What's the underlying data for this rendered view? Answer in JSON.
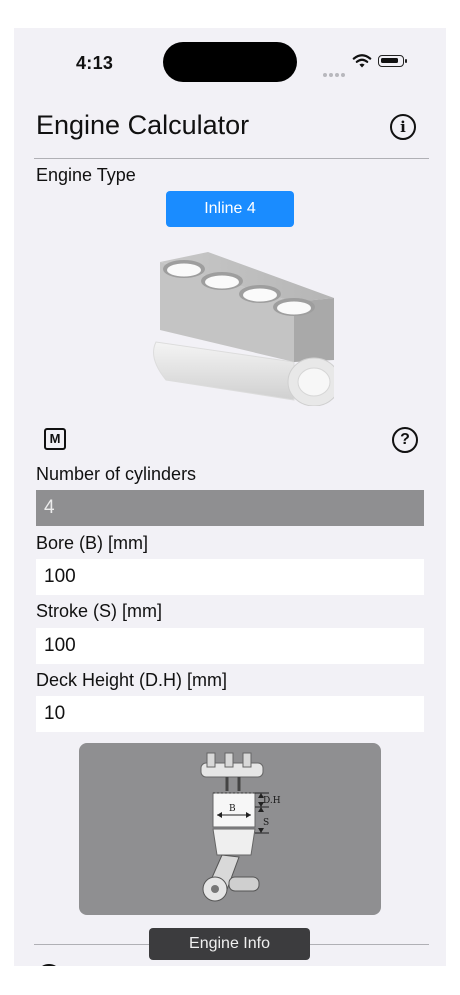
{
  "status_bar": {
    "time": "4:13"
  },
  "header": {
    "title": "Engine Calculator",
    "info_icon": "info-circle-icon"
  },
  "engine_type": {
    "label": "Engine Type",
    "selected": "Inline 4",
    "button_color": "#1a8cff"
  },
  "controls": {
    "mode_button": "M",
    "help_button": "?"
  },
  "fields": {
    "cylinders": {
      "label": "Number of cylinders",
      "value": "4"
    },
    "bore": {
      "label": "Bore (B) [mm]",
      "value": "100"
    },
    "stroke": {
      "label": "Stroke (S) [mm]",
      "value": "100"
    },
    "deck_height": {
      "label": "Deck Height (D.H) [mm]",
      "value": "10"
    }
  },
  "diagram": {
    "dh_label": "D.H",
    "s_label": "S",
    "b_label": "B"
  },
  "toast": {
    "text": "Engine Info"
  }
}
